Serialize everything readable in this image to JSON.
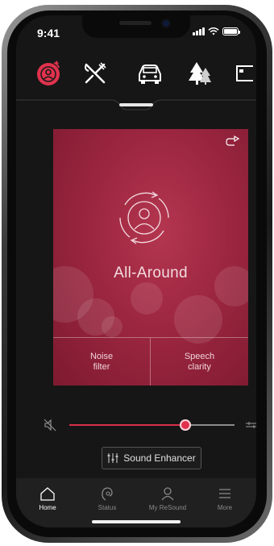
{
  "status_bar": {
    "time": "9:41"
  },
  "programs": {
    "items": [
      {
        "icon": "ear-sound-icon",
        "active": true
      },
      {
        "icon": "utensils-icon",
        "active": false
      },
      {
        "icon": "car-icon",
        "active": false
      },
      {
        "icon": "trees-icon",
        "active": false
      },
      {
        "icon": "tv-icon",
        "active": false
      }
    ]
  },
  "card": {
    "title": "All-Around",
    "corner_icon": "share-icon",
    "noise_filter_label_line1": "Noise",
    "noise_filter_label_line2": "filter",
    "speech_clarity_label_line1": "Speech",
    "speech_clarity_label_line2": "clarity"
  },
  "volume": {
    "level": 0.7
  },
  "sound_enhancer": {
    "label": "Sound Enhancer"
  },
  "tabbar": {
    "home": "Home",
    "status": "Status",
    "my_resound": "My ReSound",
    "more": "More"
  },
  "colors": {
    "accent": "#e0324d",
    "card": "#9c2640",
    "background": "#161616"
  }
}
